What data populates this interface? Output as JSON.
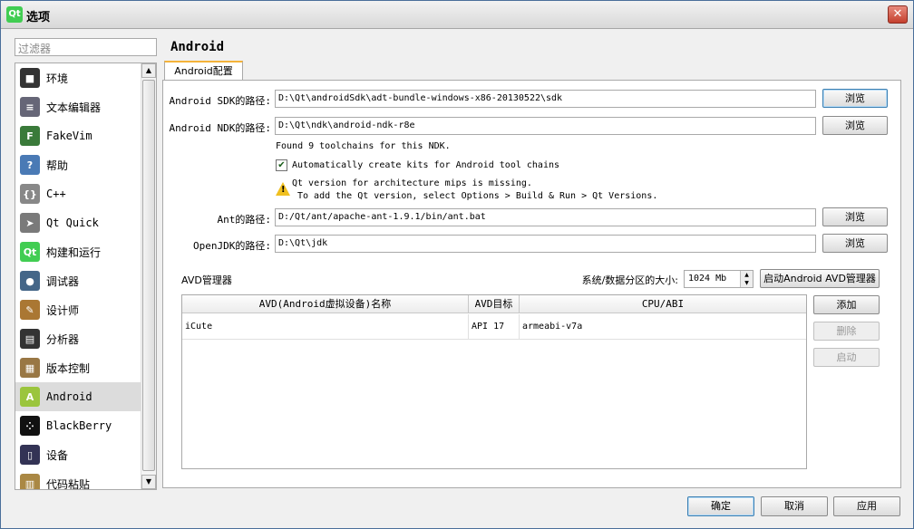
{
  "window": {
    "title": "选项",
    "app_icon": "Qt",
    "close_glyph": "✕"
  },
  "filter": {
    "placeholder": "过滤器"
  },
  "sidebar": {
    "items": [
      {
        "label": "环境",
        "icon": "monitor-icon"
      },
      {
        "label": "文本编辑器",
        "icon": "text-editor-icon"
      },
      {
        "label": "FakeVim",
        "icon": "fakevim-icon"
      },
      {
        "label": "帮助",
        "icon": "help-icon"
      },
      {
        "label": "C++",
        "icon": "cpp-braces-icon"
      },
      {
        "label": "Qt Quick",
        "icon": "qt-quick-icon"
      },
      {
        "label": "构建和运行",
        "icon": "build-run-icon"
      },
      {
        "label": "调试器",
        "icon": "debugger-icon"
      },
      {
        "label": "设计师",
        "icon": "designer-icon"
      },
      {
        "label": "分析器",
        "icon": "analyzer-icon"
      },
      {
        "label": "版本控制",
        "icon": "version-control-icon"
      },
      {
        "label": "Android",
        "icon": "android-icon",
        "selected": true
      },
      {
        "label": "BlackBerry",
        "icon": "blackberry-icon"
      },
      {
        "label": "设备",
        "icon": "device-icon"
      },
      {
        "label": "代码粘贴",
        "icon": "code-paste-icon"
      }
    ]
  },
  "page": {
    "title": "Android",
    "tab_label": "Android配置"
  },
  "form": {
    "sdk_label": "Android SDK的路径:",
    "sdk_value": "D:\\Qt\\androidSdk\\adt-bundle-windows-x86-20130522\\sdk",
    "ndk_label": "Android NDK的路径:",
    "ndk_value": "D:\\Qt\\ndk\\android-ndk-r8e",
    "browse_label": "浏览",
    "toolchains_note": "Found 9 toolchains for this NDK.",
    "auto_kits_label": "Automatically create kits for Android tool chains",
    "auto_kits_checked": true,
    "warning_line1": "Qt version for architecture mips is missing.",
    "warning_line2": "To add the Qt version, select Options > Build & Run > Qt Versions.",
    "ant_label": "Ant的路径:",
    "ant_value": "D:/Qt/ant/apache-ant-1.9.1/bin/ant.bat",
    "jdk_label": "OpenJDK的路径:",
    "jdk_value": "D:\\Qt\\jdk"
  },
  "avd": {
    "section_label": "AVD管理器",
    "partition_label": "系统/数据分区的大小:",
    "partition_value": "1024 Mb",
    "start_manager_label": "启动Android AVD管理器",
    "columns": [
      "AVD(Android虚拟设备)名称",
      "AVD目标",
      "CPU/ABI"
    ],
    "rows": [
      {
        "name": "iCute",
        "target": "API 17",
        "abi": "armeabi-v7a"
      }
    ],
    "add_label": "添加",
    "delete_label": "删除",
    "start_label": "启动"
  },
  "footer": {
    "ok_label": "确定",
    "cancel_label": "取消",
    "apply_label": "应用"
  },
  "colors": {
    "tab_accent": "#f4b33a",
    "qt_green": "#41cd52",
    "default_button_border": "#3c7fb1"
  }
}
